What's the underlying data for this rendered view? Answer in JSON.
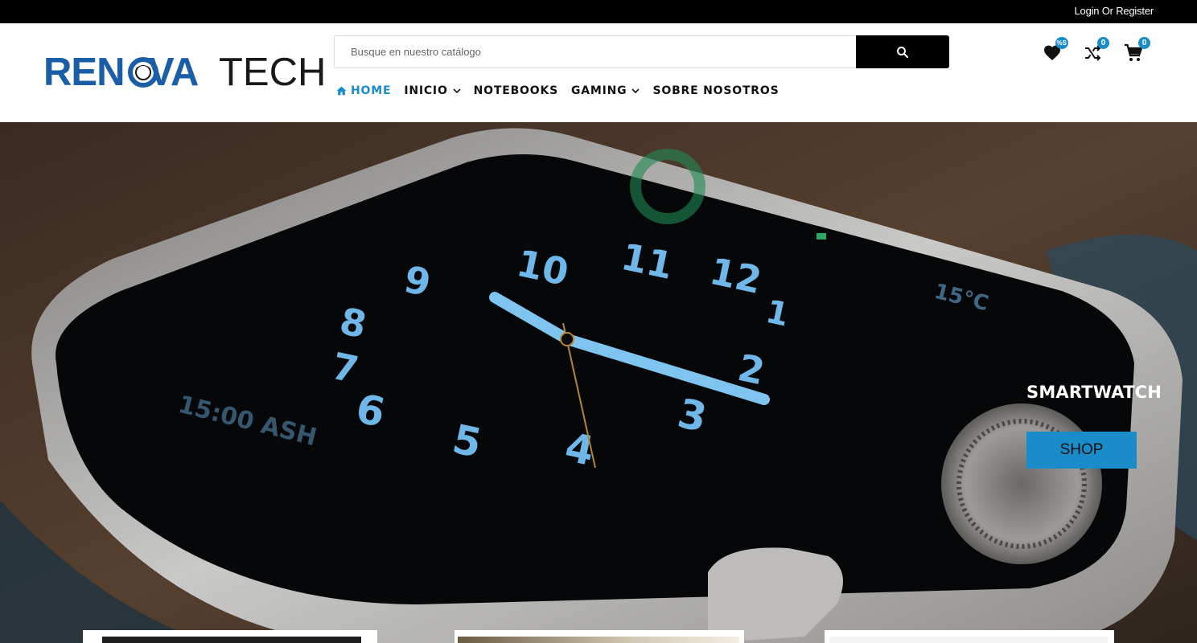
{
  "topbar": {
    "login_label": "Login Or Register"
  },
  "logo": {
    "part1": "REN",
    "part2": "VA",
    "part3": "TECH"
  },
  "search": {
    "placeholder": "Busque en nuestro catálogo"
  },
  "header_icons": {
    "wishlist": {
      "icon": "heart-icon",
      "badge": "%S"
    },
    "compare": {
      "icon": "shuffle-icon",
      "badge": "0"
    },
    "cart": {
      "icon": "cart-icon",
      "badge": "0"
    }
  },
  "nav": {
    "items": [
      {
        "label": "HOME",
        "icon": "home-icon",
        "active": true
      },
      {
        "label": "INICIO",
        "dropdown": true
      },
      {
        "label": "NOTEBOOKS"
      },
      {
        "label": "GAMING",
        "dropdown": true
      },
      {
        "label": "SOBRE NOSOTROS"
      }
    ]
  },
  "hero": {
    "title": "SMARTWATCH",
    "button_label": "SHOP",
    "image": "smartwatch-closeup"
  },
  "colors": {
    "accent": "#1a8cc9",
    "brand_blue": "#1b5ea8",
    "topbar": "#000000"
  }
}
